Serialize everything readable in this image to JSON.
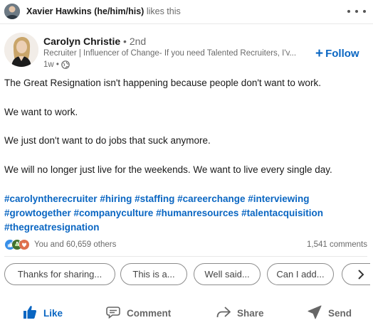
{
  "activity": {
    "actor_name": "Xavier Hawkins (he/him/his)",
    "action_text": "likes this",
    "more_icon": "more-horizontal-icon"
  },
  "author": {
    "name": "Carolyn Christie",
    "degree": "• 2nd",
    "headline": "Recruiter | Influencer of Change- If you need Talented Recruiters, I'v...",
    "time": "1w •",
    "visibility_icon": "globe-icon",
    "follow_label": "Follow",
    "follow_icon": "plus-icon"
  },
  "post": {
    "paragraphs": [
      "The Great Resignation isn't happening because people don't want to work.",
      "We want to work.",
      "We just don't want to do jobs that suck anymore.",
      "We will no longer just live for the weekends. We want to live every single day."
    ],
    "hashtags": [
      "#carolyntherecruiter",
      "#hiring",
      "#staffing",
      "#careerchange",
      "#interviewing",
      "#growtogether",
      "#companyculture",
      "#humanresources",
      "#talentacquisition",
      "#thegreatresignation"
    ]
  },
  "social": {
    "reaction_icons": [
      "like-reaction-icon",
      "celebrate-reaction-icon",
      "love-reaction-icon"
    ],
    "reactions_text": "You and 60,659 others",
    "comments_text": "1,541 comments"
  },
  "suggested_comments": [
    "Thanks for sharing...",
    "This is a...",
    "Well said...",
    "Can I add..."
  ],
  "actions": {
    "like": "Like",
    "comment": "Comment",
    "share": "Share",
    "send": "Send"
  },
  "colors": {
    "brand_blue": "#0a66c2",
    "text_secondary": "#666666",
    "divider": "#e8e8e8"
  }
}
